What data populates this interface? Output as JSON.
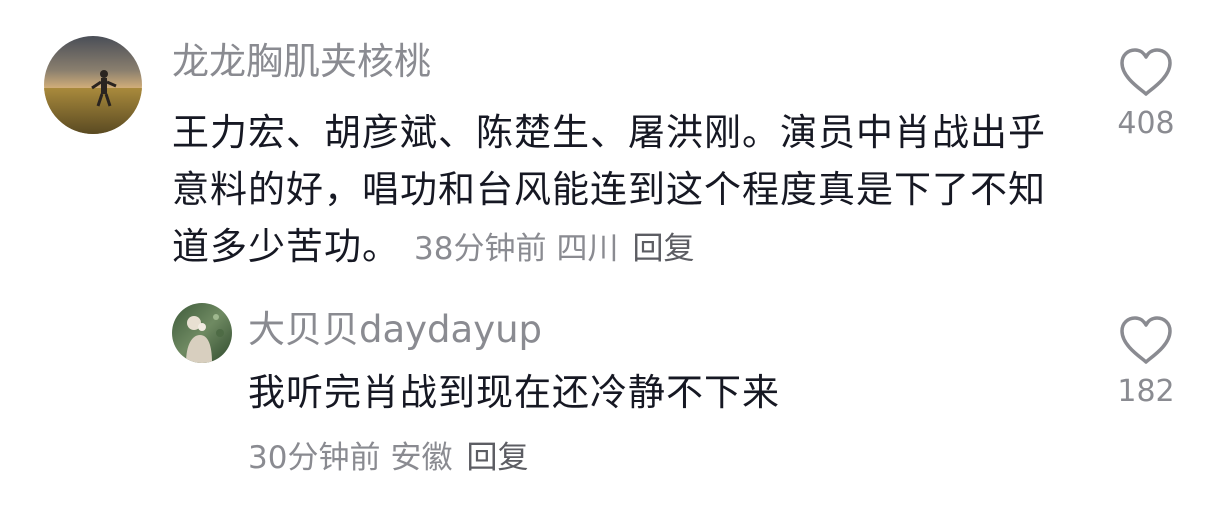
{
  "comment": {
    "username": "龙龙胸肌夹核桃",
    "text": "王力宏、胡彦斌、陈楚生、屠洪刚。演员中肖战出乎意料的好，唱功和台风能连到这个程度真是下了不知道多少苦功。",
    "time": "38分钟前",
    "location": "四川",
    "reply_label": "回复",
    "likes": "408",
    "like_icon": "heart-outline-icon"
  },
  "reply": {
    "username": "大贝贝daydayup",
    "text": "我听完肖战到现在还冷静不下来",
    "time": "30分钟前",
    "location": "安徽",
    "reply_label": "回复",
    "likes": "182",
    "like_icon": "heart-outline-icon"
  }
}
